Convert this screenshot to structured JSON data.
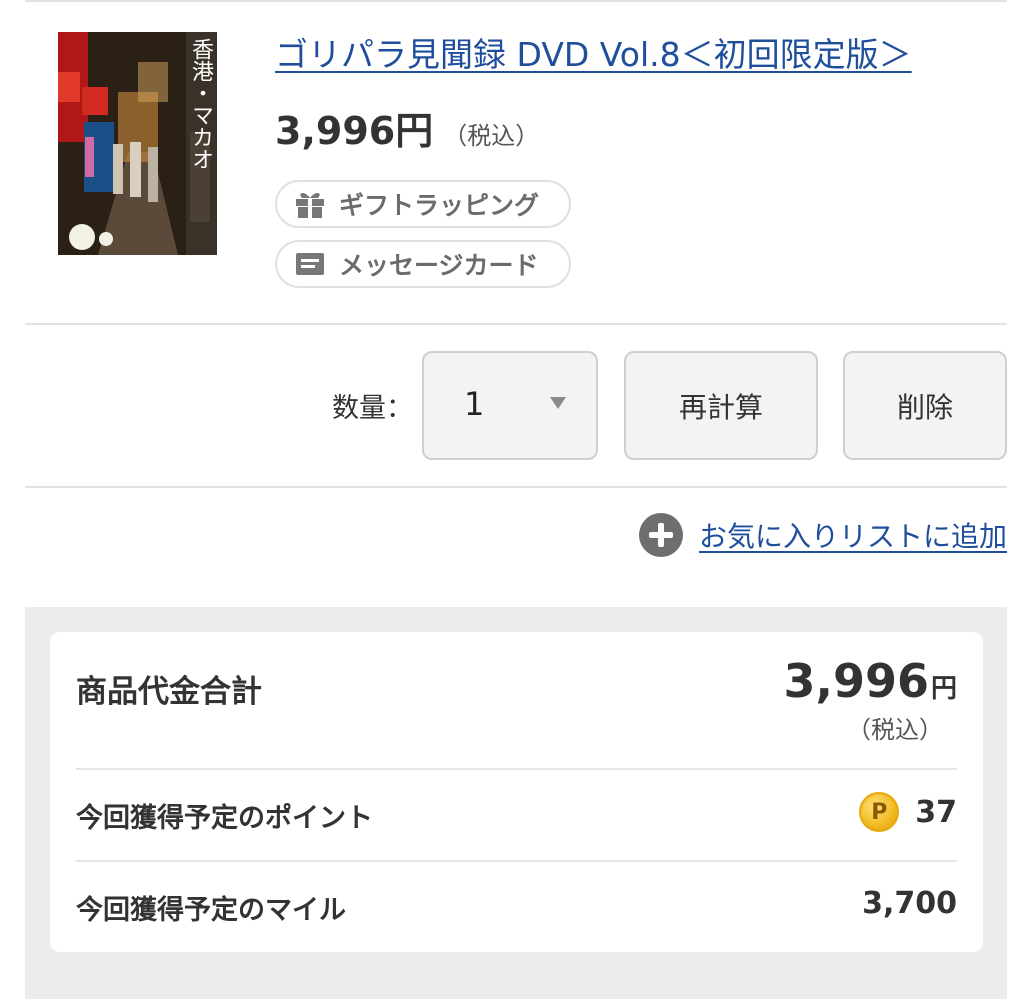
{
  "product": {
    "title": "ゴリパラ見聞録 DVD Vol.8＜初回限定版＞",
    "price": "3,996円",
    "price_tax_note": "（税込）",
    "cover_text": "香港・マカオ",
    "gift_wrapping_label": "ギフトラッピング",
    "message_card_label": "メッセージカード",
    "icons": {
      "gift": "gift-icon",
      "message": "message-card-icon"
    }
  },
  "quantity": {
    "label": "数量：",
    "value": "1"
  },
  "buttons": {
    "recalculate": "再計算",
    "delete": "削除"
  },
  "favorite": {
    "label": "お気に入りリストに追加",
    "icon": "plus-circle-icon"
  },
  "summary": {
    "total_label": "商品代金合計",
    "total_amount": "3,996",
    "total_currency": "円",
    "total_tax_note": "（税込）",
    "points_label": "今回獲得予定のポイント",
    "points_icon_letter": "P",
    "points_value": "37",
    "miles_label": "今回獲得予定のマイル",
    "miles_value": "3,700"
  },
  "colors": {
    "link": "#1f4e9c",
    "summary_background": "#ececec",
    "coin": "#f2b91f"
  }
}
